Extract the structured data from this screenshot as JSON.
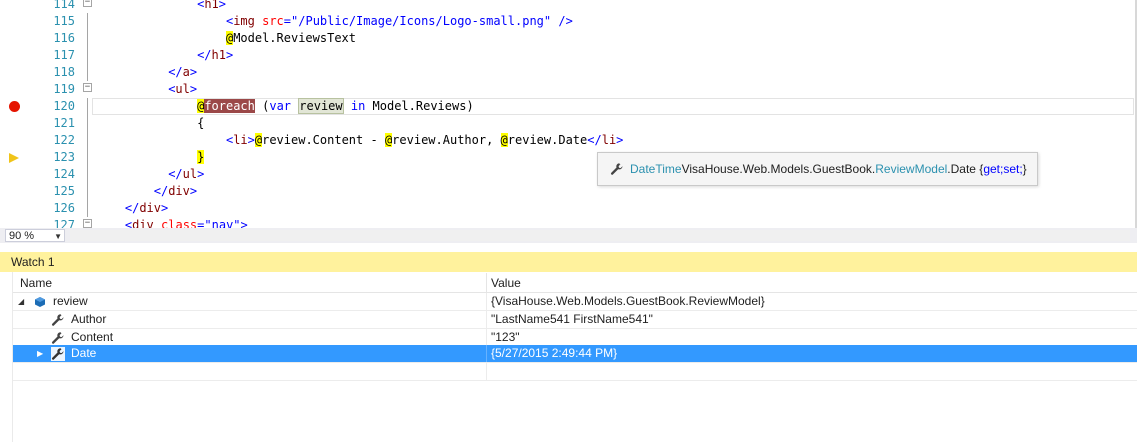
{
  "editor": {
    "lines": [
      {
        "num": "114",
        "tokens": [
          {
            "t": "<",
            "c": "br"
          },
          {
            "t": "h1",
            "c": "tag"
          },
          {
            "t": ">",
            "c": "br"
          }
        ],
        "indent": 14,
        "outline": "box"
      },
      {
        "num": "115",
        "tokens": [
          {
            "t": "<",
            "c": "br"
          },
          {
            "t": "img",
            "c": "tag"
          },
          {
            "t": " ",
            "c": ""
          },
          {
            "t": "src",
            "c": "attr"
          },
          {
            "t": "=",
            "c": "br"
          },
          {
            "t": "\"/Public/Image/Icons/Logo-small.png\"",
            "c": "str"
          },
          {
            "t": " />",
            "c": "br"
          }
        ],
        "indent": 18,
        "outline": "line"
      },
      {
        "num": "116",
        "tokens": [
          {
            "t": "@",
            "c": "razor"
          },
          {
            "t": "Model.ReviewsText",
            "c": ""
          }
        ],
        "indent": 18,
        "outline": "line"
      },
      {
        "num": "117",
        "tokens": [
          {
            "t": "</",
            "c": "br"
          },
          {
            "t": "h1",
            "c": "tag"
          },
          {
            "t": ">",
            "c": "br"
          }
        ],
        "indent": 14,
        "outline": "line"
      },
      {
        "num": "118",
        "tokens": [
          {
            "t": "</",
            "c": "br"
          },
          {
            "t": "a",
            "c": "tag"
          },
          {
            "t": ">",
            "c": "br"
          }
        ],
        "indent": 10,
        "outline": "line"
      },
      {
        "num": "119",
        "tokens": [
          {
            "t": "<",
            "c": "br"
          },
          {
            "t": "ul",
            "c": "tag"
          },
          {
            "t": ">",
            "c": "br"
          }
        ],
        "indent": 10,
        "outline": "box"
      },
      {
        "num": "120",
        "tokens": [
          {
            "t": "@",
            "c": "at-red"
          },
          {
            "t": "foreach",
            "c": "foreach-hl"
          },
          {
            "t": " (",
            "c": ""
          },
          {
            "t": "var",
            "c": "kw"
          },
          {
            "t": " ",
            "c": ""
          },
          {
            "t": "review",
            "c": "review-hl"
          },
          {
            "t": " ",
            "c": ""
          },
          {
            "t": "in",
            "c": "kw"
          },
          {
            "t": " Model.Reviews)",
            "c": ""
          }
        ],
        "indent": 14,
        "outline": "line",
        "marker": "breakpoint",
        "current": true
      },
      {
        "num": "121",
        "tokens": [
          {
            "t": "{",
            "c": ""
          }
        ],
        "indent": 14,
        "outline": "line"
      },
      {
        "num": "122",
        "tokens": [
          {
            "t": "<",
            "c": "br"
          },
          {
            "t": "li",
            "c": "tag"
          },
          {
            "t": ">",
            "c": "br"
          },
          {
            "t": "@",
            "c": "razor"
          },
          {
            "t": "review.Content - ",
            "c": ""
          },
          {
            "t": "@",
            "c": "razor"
          },
          {
            "t": "review.Author, ",
            "c": ""
          },
          {
            "t": "@",
            "c": "razor"
          },
          {
            "t": "review.Date",
            "c": ""
          },
          {
            "t": "</",
            "c": "br"
          },
          {
            "t": "li",
            "c": "tag"
          },
          {
            "t": ">",
            "c": "br"
          }
        ],
        "indent": 18,
        "outline": "line"
      },
      {
        "num": "123",
        "tokens": [
          {
            "t": "}",
            "c": "razor"
          }
        ],
        "indent": 14,
        "outline": "line",
        "marker": "current"
      },
      {
        "num": "124",
        "tokens": [
          {
            "t": "</",
            "c": "br"
          },
          {
            "t": "ul",
            "c": "tag"
          },
          {
            "t": ">",
            "c": "br"
          }
        ],
        "indent": 10,
        "outline": "line"
      },
      {
        "num": "125",
        "tokens": [
          {
            "t": "</",
            "c": "br"
          },
          {
            "t": "div",
            "c": "tag"
          },
          {
            "t": ">",
            "c": "br"
          }
        ],
        "indent": 8,
        "outline": "line"
      },
      {
        "num": "126",
        "tokens": [
          {
            "t": "</",
            "c": "br"
          },
          {
            "t": "div",
            "c": "tag"
          },
          {
            "t": ">",
            "c": "br"
          }
        ],
        "indent": 4,
        "outline": "line"
      },
      {
        "num": "127",
        "tokens": [
          {
            "t": "<",
            "c": "br"
          },
          {
            "t": "div",
            "c": "tag"
          },
          {
            "t": " ",
            "c": ""
          },
          {
            "t": "class",
            "c": "attr"
          },
          {
            "t": "=",
            "c": "br"
          },
          {
            "t": "\"nav\"",
            "c": "str"
          },
          {
            "t": ">",
            "c": "br"
          }
        ],
        "indent": 4,
        "outline": "box"
      }
    ]
  },
  "tooltip": {
    "type": "DateTime",
    "namespace": " VisaHouse.Web.Models.GuestBook.",
    "class": "ReviewModel",
    "member": ".Date { ",
    "get": "get;",
    "space": " ",
    "set": "set;",
    "close": " }"
  },
  "zoom": {
    "value": "90 %"
  },
  "watch": {
    "title": "Watch 1",
    "col_name": "Name",
    "col_value": "Value",
    "rows": [
      {
        "name": "review",
        "value": "{VisaHouse.Web.Models.GuestBook.ReviewModel}"
      },
      {
        "name": "Author",
        "value": "\"LastName541 FirstName541\""
      },
      {
        "name": "Content",
        "value": "\"123\""
      },
      {
        "name": "Date",
        "value": "{5/27/2015 2:49:44 PM}"
      }
    ]
  },
  "colors": {
    "watch_title_bg": "#fff29d",
    "selection": "#3399ff",
    "breakpoint": "#e51400",
    "line_number": "#2b91af"
  }
}
